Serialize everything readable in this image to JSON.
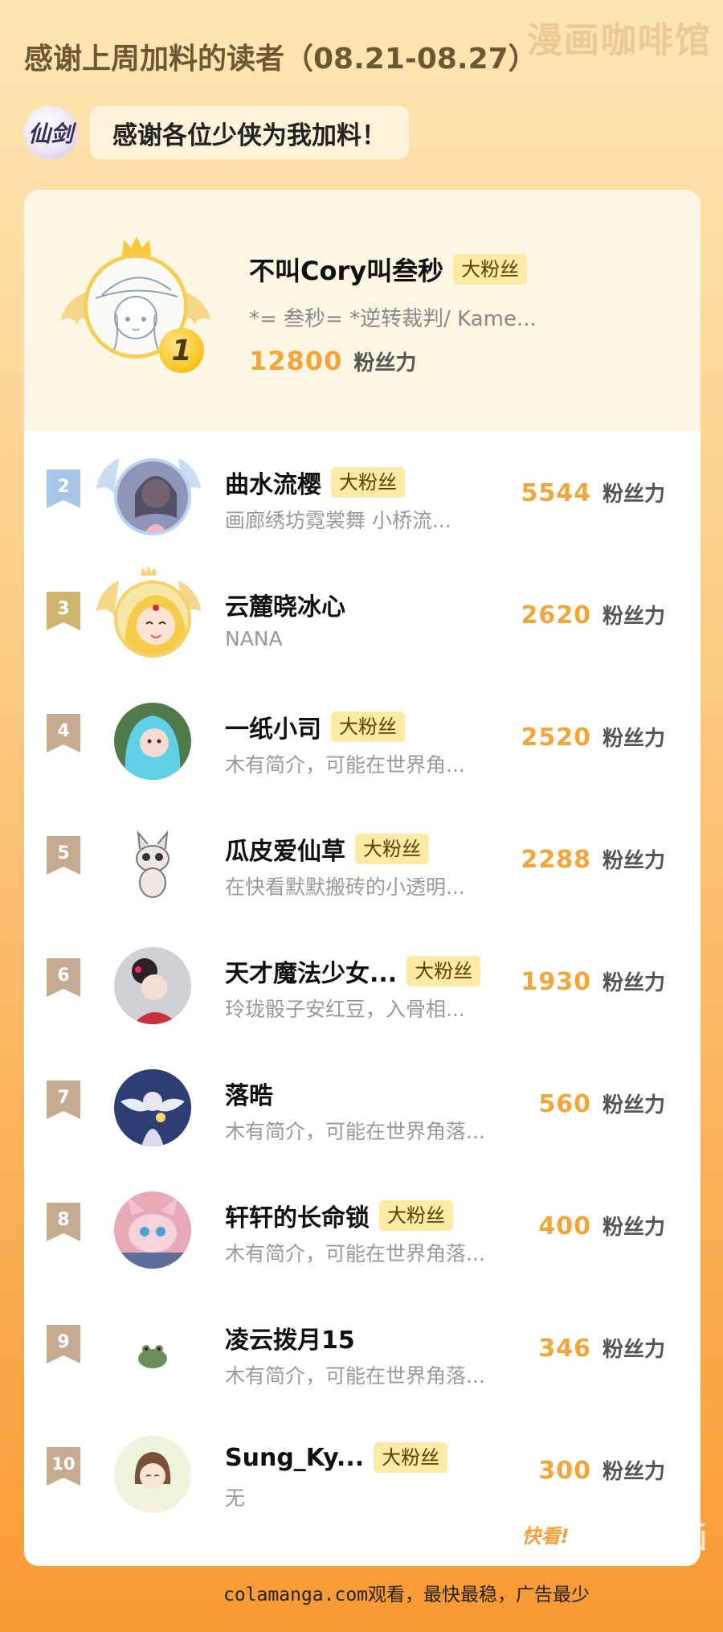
{
  "watermark_top": "漫画咖啡馆",
  "header": {
    "title": "感谢上周加料的读者（08.21-08.27）"
  },
  "banner": {
    "logo_text": "仙剑",
    "message": "感谢各位少侠为我加料！"
  },
  "fan_tag_label": "大粉丝",
  "score_unit": "粉丝力",
  "top1": {
    "rank": "1",
    "name": "不叫Cory叫叁秒",
    "bio": "*= 叁秒= *逆转裁判/ Kame...",
    "score": "12800",
    "has_fan_tag": true
  },
  "rows": [
    {
      "rank": "2",
      "name": "曲水流樱",
      "bio": "画廊绣坊霓裳舞 小桥流...",
      "score": "5544",
      "has_fan_tag": true,
      "avatar": "sakura-girl"
    },
    {
      "rank": "3",
      "name": "云麓晓冰心",
      "bio": "NANA",
      "score": "2620",
      "has_fan_tag": false,
      "avatar": "sailor-moon"
    },
    {
      "rank": "4",
      "name": "一纸小司",
      "bio": "木有简介，可能在世界角...",
      "score": "2520",
      "has_fan_tag": true,
      "avatar": "cosplay-girl"
    },
    {
      "rank": "5",
      "name": "瓜皮爱仙草",
      "bio": "在快看默默搬砖的小透明...",
      "score": "2288",
      "has_fan_tag": true,
      "avatar": "cartoon-cat"
    },
    {
      "rank": "6",
      "name": "天才魔法少女...",
      "bio": "玲珑骰子安红豆，入骨相...",
      "score": "1930",
      "has_fan_tag": true,
      "avatar": "ancient-girl"
    },
    {
      "rank": "7",
      "name": "落晧",
      "bio": "木有简介，可能在世界角落...",
      "score": "560",
      "has_fan_tag": false,
      "avatar": "angel-girl"
    },
    {
      "rank": "8",
      "name": "轩轩的长命锁",
      "bio": "木有简介，可能在世界角落...",
      "score": "400",
      "has_fan_tag": true,
      "avatar": "pink-bunny"
    },
    {
      "rank": "9",
      "name": "凌云拨月15",
      "bio": "木有简介，可能在世界角落...",
      "score": "346",
      "has_fan_tag": false,
      "avatar": "green-frog"
    },
    {
      "rank": "10",
      "name": "Sung_Ky...",
      "bio": "无",
      "score": "300",
      "has_fan_tag": true,
      "avatar": "sketch-girl"
    }
  ],
  "footer_watermark": {
    "logo_text": "快看!",
    "text": "快看漫画"
  },
  "footer_text": "colamanga.com观看，最快最稳，广告最少",
  "colors": {
    "accent_score": "#f1a53a",
    "gold": "#f8c21f",
    "silver": "#a8c4e6",
    "bronze": "#cdb56e",
    "flag": "#c6ab90"
  }
}
